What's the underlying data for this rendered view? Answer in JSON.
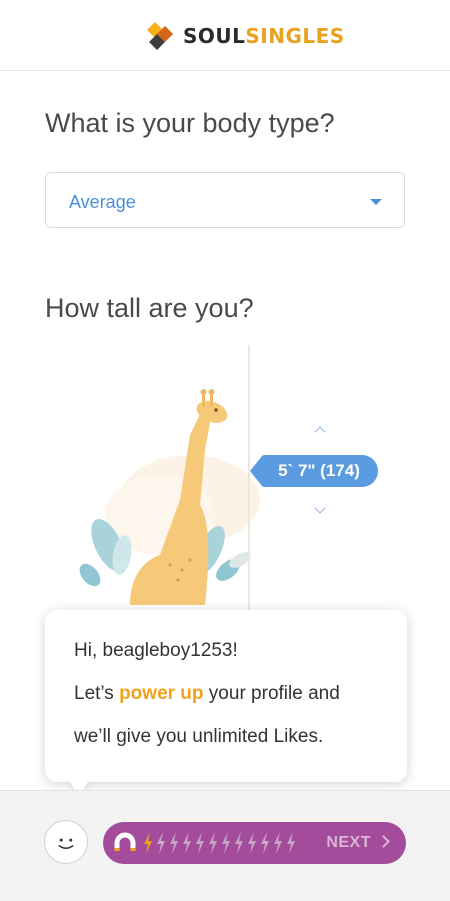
{
  "brand": {
    "soul": "SOUL",
    "singles": "SINGLES",
    "accent": "#e9a21f"
  },
  "body_type": {
    "question": "What is your body type?",
    "selected": "Average"
  },
  "height": {
    "question": "How tall are you?",
    "value": "5` 7\" (174)"
  },
  "bubble": {
    "greeting": "Hi, beagleboy1253!",
    "line2_pre": "Let’s ",
    "line2_highlight": "power up",
    "line2_post": " your profile and",
    "line3": "we’ll give you unlimited Likes."
  },
  "footer": {
    "next_label": "NEXT",
    "progress_color": "#a34c9b",
    "bolts_total": 12,
    "bolts_filled": 1
  },
  "icons": [
    "logo-mark-icon",
    "chevron-down-icon",
    "chevron-up-icon",
    "smiley-icon",
    "magnet-icon",
    "bolt-icon",
    "chevron-right-icon"
  ]
}
